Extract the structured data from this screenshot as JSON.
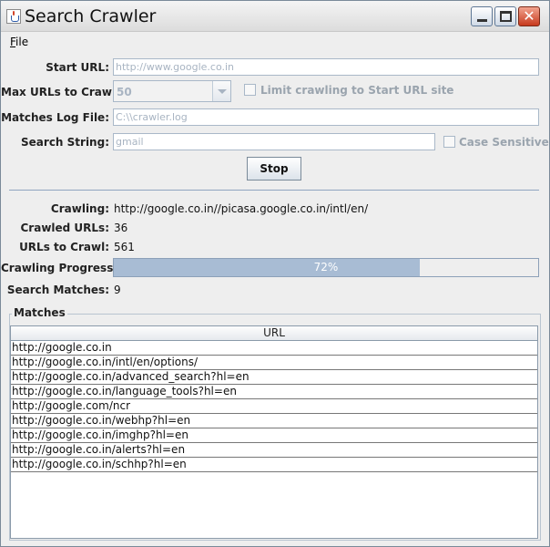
{
  "window": {
    "title": "Search Crawler"
  },
  "menu": {
    "file_prefix": "F",
    "file_rest": "ile"
  },
  "form": {
    "start_url_label": "Start URL:",
    "start_url_value": "http://www.google.co.in",
    "max_urls_label": "Max URLs to Crawl:",
    "max_urls_value": "50",
    "limit_label": "Limit crawling to Start URL site",
    "limit_checked": false,
    "log_file_label": "Matches Log File:",
    "log_file_value": "C:\\\\crawler.log",
    "search_label": "Search String:",
    "search_value": "gmail",
    "case_label": "Case Sensitive",
    "case_checked": false,
    "stop_label": "Stop"
  },
  "status": {
    "crawling_label": "Crawling:",
    "crawling_value": "http://google.co.in//picasa.google.co.in/intl/en/",
    "crawled_label": "Crawled URLs:",
    "crawled_value": "36",
    "to_crawl_label": "URLs to Crawl:",
    "to_crawl_value": "561",
    "progress_label": "Crawling Progress:",
    "progress_percent": 72,
    "progress_text": "72%",
    "matches_label": "Search Matches:",
    "matches_value": "9"
  },
  "matches": {
    "title": "Matches",
    "column": "URL",
    "rows": [
      "http://google.co.in",
      "http://google.co.in/intl/en/options/",
      "http://google.co.in/advanced_search?hl=en",
      "http://google.co.in/language_tools?hl=en",
      "http://google.com/ncr",
      "http://google.co.in/webhp?hl=en",
      "http://google.co.in/imghp?hl=en",
      "http://google.co.in/alerts?hl=en",
      "http://google.co.in/schhp?hl=en"
    ]
  }
}
